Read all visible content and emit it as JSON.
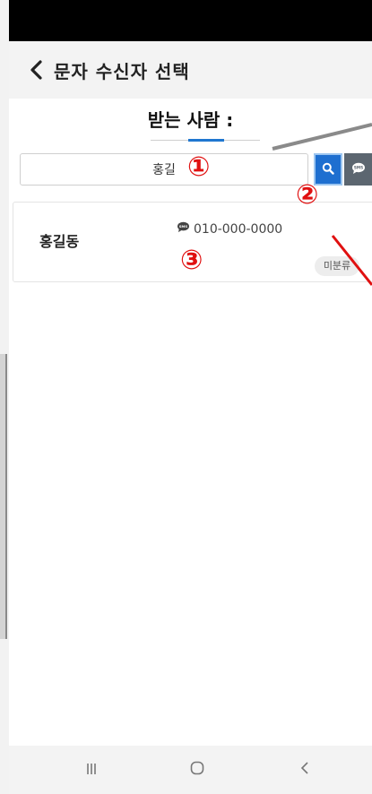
{
  "app_bar": {
    "title": "문자 수신자 선택"
  },
  "recipient": {
    "label": "받는 사람 :"
  },
  "search": {
    "value": "홍길",
    "placeholder": ""
  },
  "results": [
    {
      "name": "홍길동",
      "phone": "010-000-0000",
      "category": "미분류"
    }
  ],
  "annotations": {
    "one": "①",
    "two": "②",
    "three": "③"
  },
  "icons": {
    "back": "chevron-left-icon",
    "search": "search-icon",
    "sms": "sms-icon",
    "nav_recent": "recent-apps-icon",
    "nav_home": "home-icon",
    "nav_back": "back-icon"
  },
  "colors": {
    "accent": "#1e6fd0",
    "annotation": "#e01010",
    "sms_button": "#5c6670"
  }
}
